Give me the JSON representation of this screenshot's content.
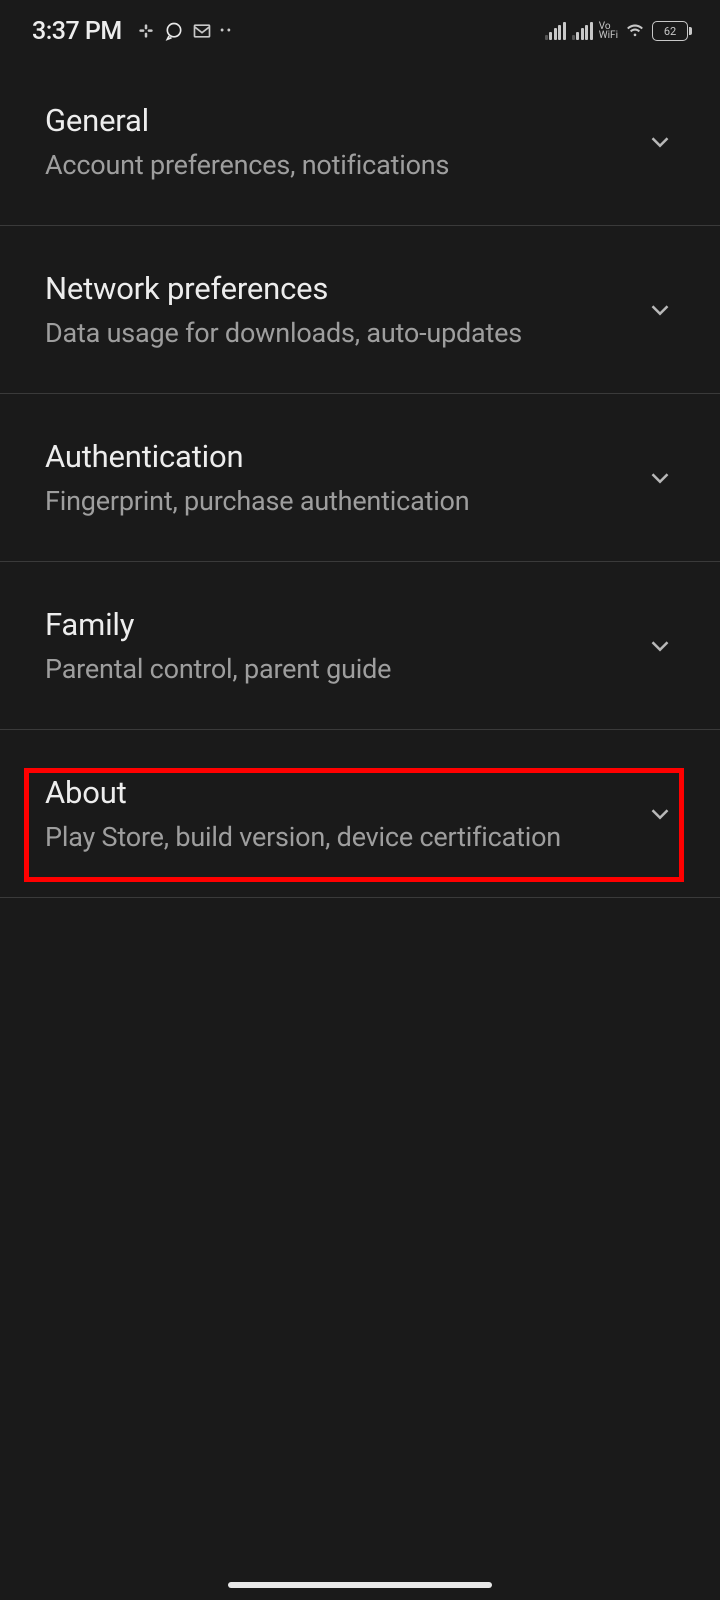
{
  "status_bar": {
    "time": "3:37 PM",
    "battery": "62"
  },
  "settings": [
    {
      "title": "General",
      "subtitle": "Account preferences, notifications"
    },
    {
      "title": "Network preferences",
      "subtitle": "Data usage for downloads, auto-updates"
    },
    {
      "title": "Authentication",
      "subtitle": "Fingerprint, purchase authentication"
    },
    {
      "title": "Family",
      "subtitle": "Parental control, parent guide"
    },
    {
      "title": "About",
      "subtitle": "Play Store, build version, device certification"
    }
  ]
}
